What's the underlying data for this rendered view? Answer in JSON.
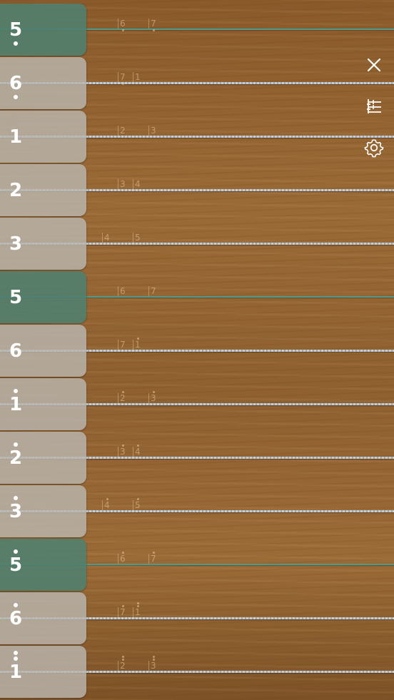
{
  "controls": [
    {
      "name": "close-icon"
    },
    {
      "name": "tuning-icon"
    },
    {
      "name": "gear-icon"
    }
  ],
  "colors": {
    "accent": "#4d9a8e",
    "key": "#bab6ae",
    "key_accent": "#4e8070",
    "string": "#c7cdd2"
  },
  "strings": [
    {
      "note": "5",
      "dots_above": 0,
      "dots_below": 1,
      "accent": true,
      "frets": [
        {
          "label": "6",
          "dots_above": 0,
          "dots_below": 1
        },
        {
          "label": "7",
          "dots_above": 0,
          "dots_below": 1
        }
      ]
    },
    {
      "note": "6",
      "dots_above": 0,
      "dots_below": 1,
      "accent": false,
      "frets": [
        {
          "label": "7",
          "dots_above": 0,
          "dots_below": 1
        },
        {
          "label": "1",
          "dots_above": 0,
          "dots_below": 0
        }
      ]
    },
    {
      "note": "1",
      "dots_above": 0,
      "dots_below": 0,
      "accent": false,
      "frets": [
        {
          "label": "2",
          "dots_above": 0,
          "dots_below": 0
        },
        {
          "label": "3",
          "dots_above": 0,
          "dots_below": 0
        }
      ]
    },
    {
      "note": "2",
      "dots_above": 0,
      "dots_below": 0,
      "accent": false,
      "frets": [
        {
          "label": "3",
          "dots_above": 0,
          "dots_below": 0
        },
        {
          "label": "4",
          "dots_above": 0,
          "dots_below": 0
        }
      ]
    },
    {
      "note": "3",
      "dots_above": 0,
      "dots_below": 0,
      "accent": false,
      "frets": [
        {
          "label": "4",
          "dots_above": 0,
          "dots_below": 0
        },
        {
          "label": "5",
          "dots_above": 0,
          "dots_below": 0
        }
      ]
    },
    {
      "note": "5",
      "dots_above": 0,
      "dots_below": 0,
      "accent": true,
      "frets": [
        {
          "label": "6",
          "dots_above": 0,
          "dots_below": 0
        },
        {
          "label": "7",
          "dots_above": 0,
          "dots_below": 0
        }
      ]
    },
    {
      "note": "6",
      "dots_above": 0,
      "dots_below": 0,
      "accent": false,
      "frets": [
        {
          "label": "7",
          "dots_above": 0,
          "dots_below": 0
        },
        {
          "label": "1",
          "dots_above": 1,
          "dots_below": 0
        }
      ]
    },
    {
      "note": "1",
      "dots_above": 1,
      "dots_below": 0,
      "accent": false,
      "frets": [
        {
          "label": "2",
          "dots_above": 1,
          "dots_below": 0
        },
        {
          "label": "3",
          "dots_above": 1,
          "dots_below": 0
        }
      ]
    },
    {
      "note": "2",
      "dots_above": 1,
      "dots_below": 0,
      "accent": false,
      "frets": [
        {
          "label": "3",
          "dots_above": 1,
          "dots_below": 0
        },
        {
          "label": "4",
          "dots_above": 1,
          "dots_below": 0
        }
      ]
    },
    {
      "note": "3",
      "dots_above": 1,
      "dots_below": 0,
      "accent": false,
      "frets": [
        {
          "label": "4",
          "dots_above": 1,
          "dots_below": 0
        },
        {
          "label": "5",
          "dots_above": 1,
          "dots_below": 0
        }
      ]
    },
    {
      "note": "5",
      "dots_above": 1,
      "dots_below": 0,
      "accent": true,
      "frets": [
        {
          "label": "6",
          "dots_above": 1,
          "dots_below": 0
        },
        {
          "label": "7",
          "dots_above": 1,
          "dots_below": 0
        }
      ]
    },
    {
      "note": "6",
      "dots_above": 1,
      "dots_below": 0,
      "accent": false,
      "frets": [
        {
          "label": "7",
          "dots_above": 1,
          "dots_below": 0
        },
        {
          "label": "1",
          "dots_above": 2,
          "dots_below": 0
        }
      ]
    },
    {
      "note": "1",
      "dots_above": 2,
      "dots_below": 0,
      "accent": false,
      "frets": [
        {
          "label": "2",
          "dots_above": 2,
          "dots_below": 0
        },
        {
          "label": "3",
          "dots_above": 2,
          "dots_below": 0
        }
      ]
    }
  ]
}
